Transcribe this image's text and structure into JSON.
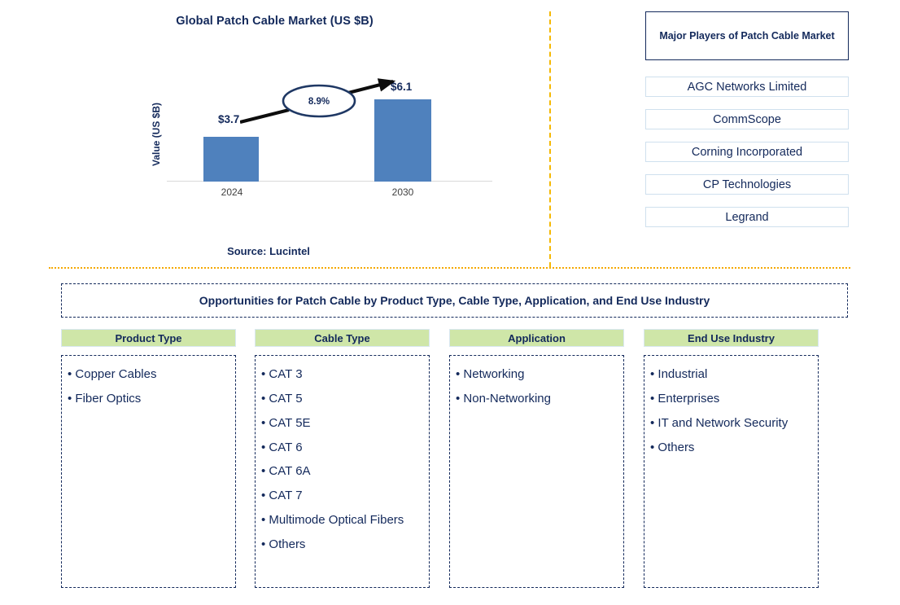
{
  "chart_data": {
    "type": "bar",
    "title": "Global Patch Cable Market (US $B)",
    "xlabel": "",
    "ylabel": "Value (US $B)",
    "categories": [
      "2024",
      "2030"
    ],
    "values": [
      3.7,
      6.1
    ],
    "value_labels": [
      "$3.7",
      "$6.1"
    ],
    "cagr": "8.9%",
    "ylim": [
      0,
      7
    ],
    "grid": false,
    "legend": "none",
    "series": [
      {
        "name": "Value (US $B)",
        "values": [
          3.7,
          6.1
        ]
      }
    ],
    "bar_color": "#4f81bd",
    "annotation": "8.9%",
    "source": "Source: Lucintel"
  },
  "chart": {
    "title": "Global Patch Cable Market (US $B)",
    "y_axis_label": "Value (US $B)",
    "categories": [
      "2024",
      "2030"
    ],
    "value_labels": [
      "$3.7",
      "$6.1"
    ],
    "cagr_label": "8.9%",
    "source": "Source: Lucintel"
  },
  "players": {
    "title": "Major Players of Patch Cable Market",
    "items": [
      "AGC Networks Limited",
      "CommScope",
      "Corning Incorporated",
      "CP Technologies",
      "Legrand"
    ]
  },
  "opportunities": {
    "banner": "Opportunities for Patch Cable by Product Type, Cable Type, Application, and End Use Industry",
    "columns": [
      {
        "header": "Product Type",
        "items": [
          "Copper Cables",
          "Fiber Optics"
        ]
      },
      {
        "header": "Cable Type",
        "items": [
          "CAT 3",
          "CAT 5",
          "CAT 5E",
          "CAT 6",
          "CAT 6A",
          "CAT 7",
          "Multimode Optical Fibers",
          "Others"
        ]
      },
      {
        "header": "Application",
        "items": [
          "Networking",
          "Non-Networking"
        ]
      },
      {
        "header": "End Use Industry",
        "items": [
          "Industrial",
          "Enterprises",
          "IT and Network Security",
          "Others"
        ]
      }
    ]
  },
  "colors": {
    "bar": "#4f81bd",
    "navy": "#13295b",
    "green_header": "#cfe6a8",
    "gold_divider": "#f5b800"
  }
}
